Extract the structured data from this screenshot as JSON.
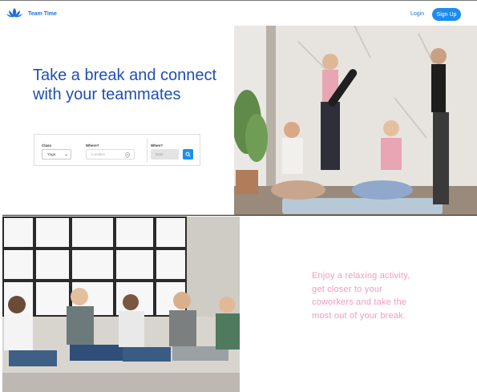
{
  "header": {
    "brand": "Team Time",
    "login": "Login",
    "signup": "Sign Up"
  },
  "hero": {
    "title": "Take a break and connect with your teammates"
  },
  "search": {
    "class_label": "Class",
    "class_value": "Yoga",
    "where_label": "Where?",
    "where_placeholder": "Location",
    "when_label": "When?",
    "when_placeholder": "Date"
  },
  "tagline": "Enjoy a relaxing activity, get closer to your coworkers and take the most out of your break.",
  "colors": {
    "brand_blue": "#1e6fd8",
    "button_blue": "#1d8cf0",
    "tagline_pink": "#f19bbf"
  },
  "icons": {
    "logo": "lotus-icon",
    "location": "map-pin-icon",
    "search": "search-icon",
    "select": "chevron-down-icon"
  }
}
